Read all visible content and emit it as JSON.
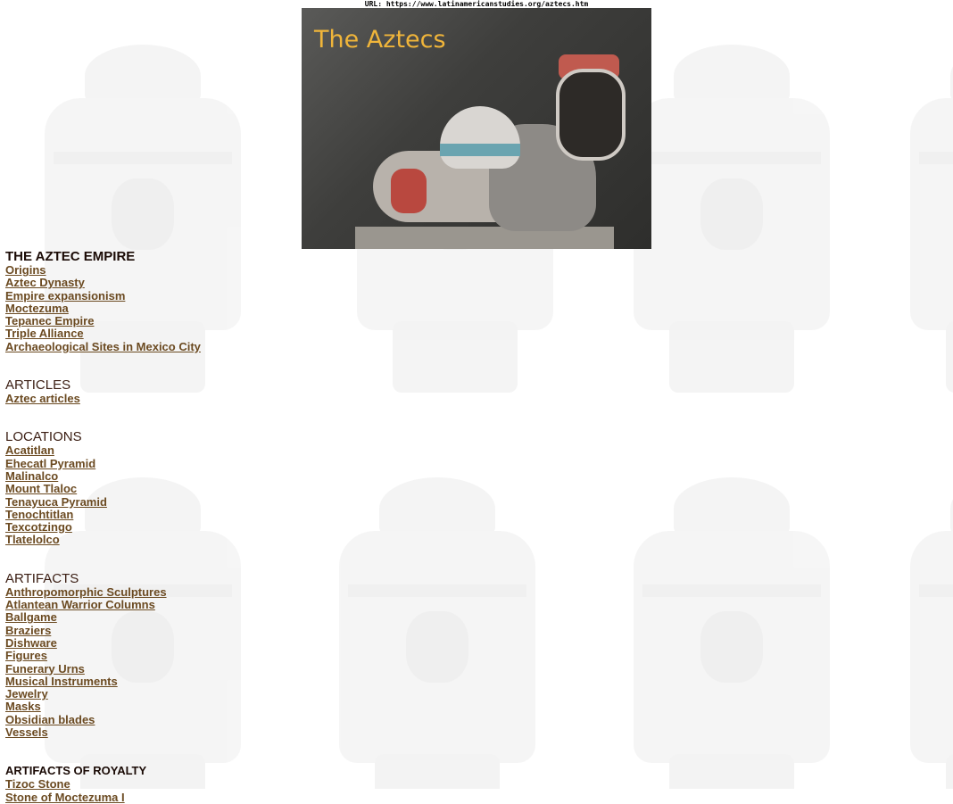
{
  "url_bar": "URL: https://www.latinamericanstudies.org/aztecs.htm",
  "banner": {
    "title": "The Aztecs"
  },
  "sections": {
    "empire": {
      "title": "THE AZTEC EMPIRE",
      "links": [
        "Origins",
        "Aztec Dynasty",
        "Empire expansionism",
        "Moctezuma",
        "Tepanec Empire",
        "Triple Alliance",
        "Archaeological Sites in Mexico City"
      ]
    },
    "articles": {
      "title": "ARTICLES",
      "links": [
        "Aztec articles"
      ]
    },
    "locations": {
      "title": "LOCATIONS",
      "links": [
        "Acatitlan",
        "Ehecatl Pyramid",
        "Malinalco",
        "Mount Tlaloc",
        "Tenayuca Pyramid",
        "Tenochtitlan",
        "Texcotzingo",
        "Tlatelolco"
      ]
    },
    "artifacts": {
      "title": "ARTIFACTS",
      "links": [
        "Anthropomorphic Sculptures",
        "Atlantean Warrior Columns",
        "Ballgame",
        "Braziers",
        "Dishware",
        "Figures",
        "Funerary Urns",
        "Musical Instruments",
        "Jewelry",
        "Masks",
        "Obsidian blades",
        "Vessels"
      ]
    },
    "royalty": {
      "title": "ARTIFACTS OF ROYALTY",
      "links": [
        "Tizoc Stone",
        "Stone of Moctezuma I"
      ]
    }
  },
  "colors": {
    "link": "#6b4a21",
    "banner_title": "#f0b53a"
  }
}
